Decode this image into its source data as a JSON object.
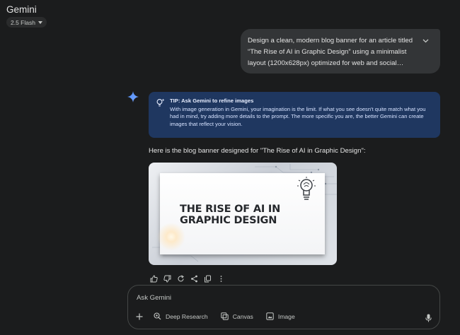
{
  "header": {
    "app_title": "Gemini",
    "model_label": "2.5 Flash"
  },
  "conversation": {
    "user_prompt": "Design a clean, modern blog banner for an article titled “The Rise of AI in Graphic Design” using a minimalist layout (1200x628px) optimized for web and social…",
    "tip": {
      "title": "TIP: Ask Gemini to refine images",
      "body": "With image generation in Gemini, your imagination is the limit. If what you see doesn't quite match what you had in mind, try adding more details to the prompt. The more specific you are, the better Gemini can create images that reflect your vision."
    },
    "response_text": "Here is the blog banner designed for \"The Rise of AI in Graphic Design\":",
    "generated_image": {
      "title_text": "THE RISE OF AI IN GRAPHIC DESIGN"
    }
  },
  "response_actions": [
    "thumbs-up-icon",
    "thumbs-down-icon",
    "regenerate-icon",
    "share-icon",
    "copy-icon",
    "more-vert-icon"
  ],
  "composer": {
    "placeholder": "Ask Gemini",
    "tools": [
      {
        "label": "Deep Research",
        "icon": "deep-research-icon"
      },
      {
        "label": "Canvas",
        "icon": "canvas-icon"
      },
      {
        "label": "Image",
        "icon": "image-icon"
      }
    ]
  },
  "colors": {
    "background": "#1b1c1d",
    "user_bubble": "#333537",
    "tip_background": "#1f3760",
    "accent_sparkle": "#4f8df7"
  }
}
